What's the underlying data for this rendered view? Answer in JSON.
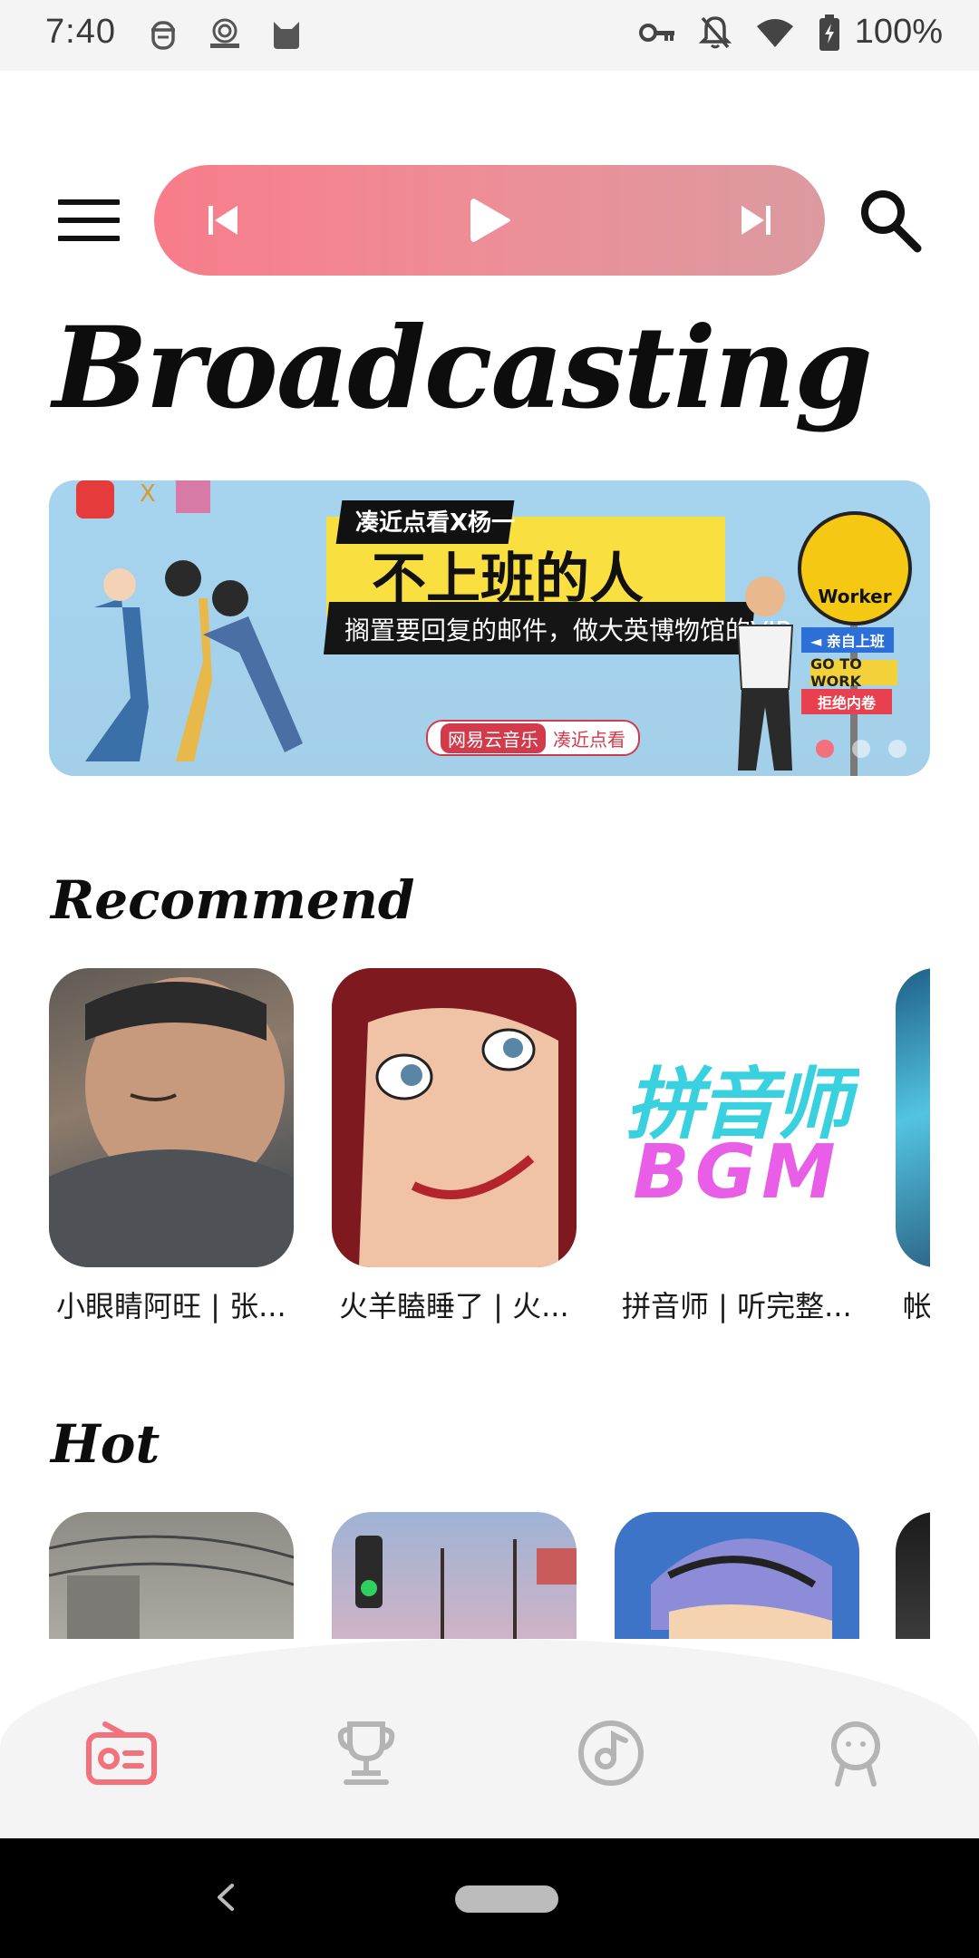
{
  "status_bar": {
    "time": "7:40",
    "battery_text": "100%",
    "icons": [
      "face-icon",
      "podcast-icon",
      "cat-icon",
      "key-icon",
      "bell-off-icon",
      "wifi-icon",
      "battery-charging-icon"
    ]
  },
  "player": {
    "previous_icon": "skip-previous-icon",
    "play_icon": "play-icon",
    "next_icon": "skip-next-icon",
    "accent": "#f87c8a"
  },
  "page": {
    "title": "Broadcasting"
  },
  "banner": {
    "headline": "不上班的人",
    "sub_headline": "凑近点看X杨一",
    "description": "搁置要回复的邮件，做大英博物馆的VIP",
    "tag_left": "网易云音乐",
    "tag_right": "凑近点看",
    "logo_x": "X",
    "sign_worker": "Worker",
    "sign_a": "◄ 亲自上班",
    "sign_b": "GO TO WORK",
    "sign_c": "拒绝内卷",
    "dots_total": 3,
    "active_dot": 0
  },
  "recommend": {
    "title": "Recommend",
    "items": [
      {
        "title": "小眼睛阿旺 | 张..."
      },
      {
        "title": "火羊瞌睡了 | 火..."
      },
      {
        "title": "拼音师 | 听完整..."
      },
      {
        "title": "帐"
      }
    ],
    "cover_text": {
      "line1": "拼音师",
      "line2": "BGM"
    }
  },
  "hot": {
    "title": "Hot"
  },
  "bottom_nav": {
    "tabs": [
      {
        "name": "radio-icon",
        "active": true
      },
      {
        "name": "trophy-icon",
        "active": false
      },
      {
        "name": "music-disc-icon",
        "active": false
      },
      {
        "name": "profile-icon",
        "active": false
      }
    ],
    "active_color": "#f3707d",
    "inactive_color": "#b4b4b4"
  }
}
